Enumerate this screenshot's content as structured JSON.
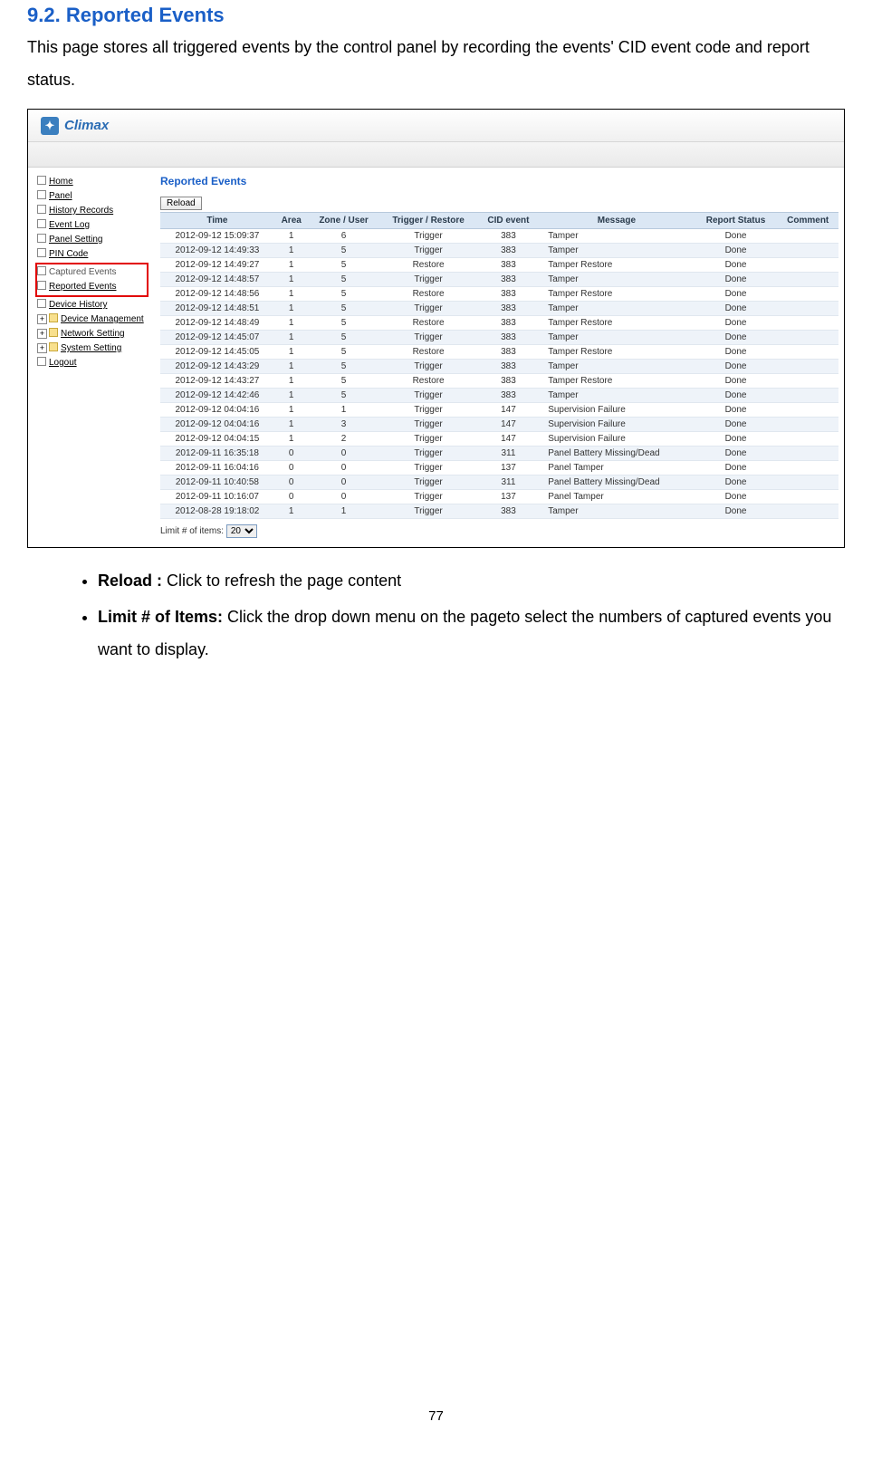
{
  "document": {
    "section_number": "9.2.",
    "section_title": "Reported Events",
    "intro": "This page stores all triggered events by the control panel by recording the events' CID event code and report status.",
    "bullets": [
      {
        "label": "Reload :",
        "text": " Click to refresh the page content"
      },
      {
        "label": "Limit # of Items:",
        "text": " Click the drop down menu on the pageto select the numbers of captured events you want to display."
      }
    ],
    "page_number": "77"
  },
  "screenshot": {
    "logo_text": "Climax",
    "sidebar": {
      "items_top": [
        "Home",
        "Panel",
        "History Records",
        "Event Log",
        "Panel Setting",
        "PIN Code"
      ],
      "highlighted": [
        "Captured Events",
        "Reported Events"
      ],
      "items_mid": [
        "Device History"
      ],
      "folders": [
        "Device Management",
        "Network Setting",
        "System Setting"
      ],
      "items_bottom": [
        "Logout"
      ]
    },
    "panel_title": "Reported Events",
    "reload_label": "Reload",
    "table": {
      "headers": [
        "Time",
        "Area",
        "Zone / User",
        "Trigger / Restore",
        "CID event",
        "Message",
        "Report Status",
        "Comment"
      ],
      "rows": [
        [
          "2012-09-12 15:09:37",
          "1",
          "6",
          "Trigger",
          "383",
          "Tamper",
          "Done",
          ""
        ],
        [
          "2012-09-12 14:49:33",
          "1",
          "5",
          "Trigger",
          "383",
          "Tamper",
          "Done",
          ""
        ],
        [
          "2012-09-12 14:49:27",
          "1",
          "5",
          "Restore",
          "383",
          "Tamper Restore",
          "Done",
          ""
        ],
        [
          "2012-09-12 14:48:57",
          "1",
          "5",
          "Trigger",
          "383",
          "Tamper",
          "Done",
          ""
        ],
        [
          "2012-09-12 14:48:56",
          "1",
          "5",
          "Restore",
          "383",
          "Tamper Restore",
          "Done",
          ""
        ],
        [
          "2012-09-12 14:48:51",
          "1",
          "5",
          "Trigger",
          "383",
          "Tamper",
          "Done",
          ""
        ],
        [
          "2012-09-12 14:48:49",
          "1",
          "5",
          "Restore",
          "383",
          "Tamper Restore",
          "Done",
          ""
        ],
        [
          "2012-09-12 14:45:07",
          "1",
          "5",
          "Trigger",
          "383",
          "Tamper",
          "Done",
          ""
        ],
        [
          "2012-09-12 14:45:05",
          "1",
          "5",
          "Restore",
          "383",
          "Tamper Restore",
          "Done",
          ""
        ],
        [
          "2012-09-12 14:43:29",
          "1",
          "5",
          "Trigger",
          "383",
          "Tamper",
          "Done",
          ""
        ],
        [
          "2012-09-12 14:43:27",
          "1",
          "5",
          "Restore",
          "383",
          "Tamper Restore",
          "Done",
          ""
        ],
        [
          "2012-09-12 14:42:46",
          "1",
          "5",
          "Trigger",
          "383",
          "Tamper",
          "Done",
          ""
        ],
        [
          "2012-09-12 04:04:16",
          "1",
          "1",
          "Trigger",
          "147",
          "Supervision Failure",
          "Done",
          ""
        ],
        [
          "2012-09-12 04:04:16",
          "1",
          "3",
          "Trigger",
          "147",
          "Supervision Failure",
          "Done",
          ""
        ],
        [
          "2012-09-12 04:04:15",
          "1",
          "2",
          "Trigger",
          "147",
          "Supervision Failure",
          "Done",
          ""
        ],
        [
          "2012-09-11 16:35:18",
          "0",
          "0",
          "Trigger",
          "311",
          "Panel Battery Missing/Dead",
          "Done",
          ""
        ],
        [
          "2012-09-11 16:04:16",
          "0",
          "0",
          "Trigger",
          "137",
          "Panel Tamper",
          "Done",
          ""
        ],
        [
          "2012-09-11 10:40:58",
          "0",
          "0",
          "Trigger",
          "311",
          "Panel Battery Missing/Dead",
          "Done",
          ""
        ],
        [
          "2012-09-11 10:16:07",
          "0",
          "0",
          "Trigger",
          "137",
          "Panel Tamper",
          "Done",
          ""
        ],
        [
          "2012-08-28 19:18:02",
          "1",
          "1",
          "Trigger",
          "383",
          "Tamper",
          "Done",
          ""
        ]
      ]
    },
    "limit_label": "Limit # of items:",
    "limit_value": "20"
  }
}
